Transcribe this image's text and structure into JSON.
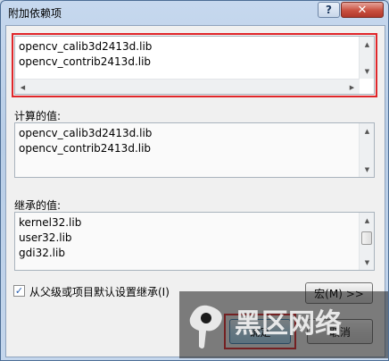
{
  "window": {
    "title": "附加依赖项",
    "help_label": "?",
    "close_label": "✕"
  },
  "input": {
    "lines": [
      "opencv_calib3d2413d.lib",
      "opencv_contrib2413d.lib"
    ]
  },
  "computed": {
    "label": "计算的值:",
    "lines": [
      "opencv_calib3d2413d.lib",
      "opencv_contrib2413d.lib"
    ]
  },
  "inherited": {
    "label": "继承的值:",
    "lines": [
      "kernel32.lib",
      "user32.lib",
      "gdi32.lib"
    ]
  },
  "inherit_checkbox": {
    "label": "从父级或项目默认设置继承(I)",
    "checked": true,
    "mark": "✓"
  },
  "macro_button": {
    "label": "宏(M) >>"
  },
  "ok_button": {
    "label": "确定"
  },
  "cancel_button": {
    "label": "取消"
  },
  "watermark": {
    "text": "黑区网络"
  },
  "colors": {
    "highlight": "#e0262a",
    "title_bar": "#c6d8ee",
    "close": "#c9503f"
  }
}
